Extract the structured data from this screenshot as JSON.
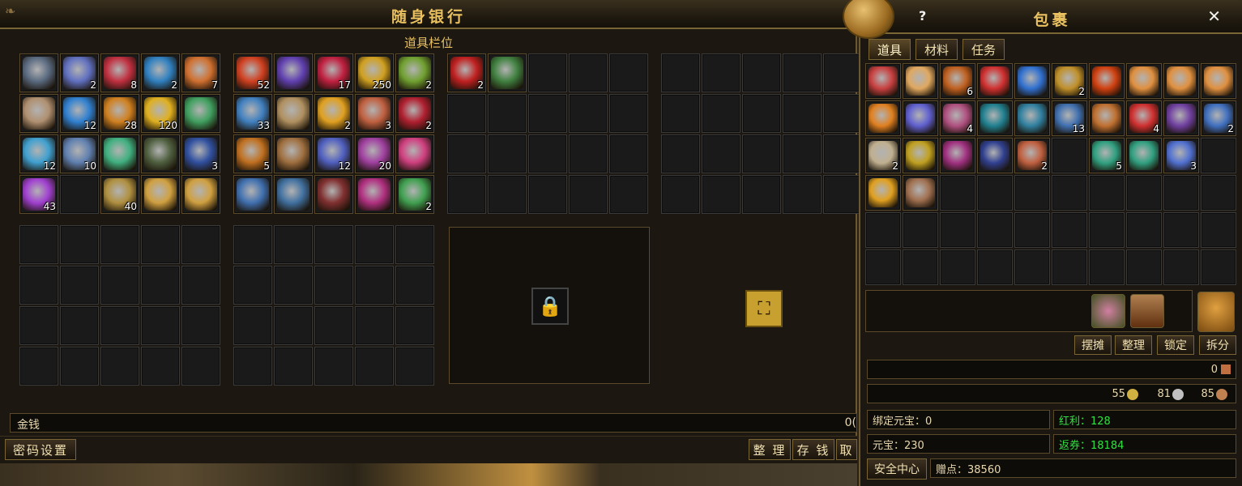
{
  "bank": {
    "title": "随身银行",
    "subtitle": "道具栏位",
    "money_label": "金钱",
    "money_value": "0(",
    "buttons": {
      "password": "密码设置",
      "sort": "整 理",
      "deposit": "存 钱",
      "withdraw": "取"
    },
    "icons": {
      "lock": "lock-icon",
      "expand": "expand-chest-icon"
    },
    "grid1_counts": [
      "",
      "2",
      "8",
      "2",
      "7",
      "",
      "12",
      "28",
      "120",
      "",
      "12",
      "10",
      "",
      "",
      "3",
      "43",
      null,
      "40",
      "",
      ""
    ],
    "grid2_counts": [
      "52",
      "",
      "17",
      "250",
      "2",
      "33",
      "",
      "2",
      "3",
      "2",
      "5",
      "",
      "12",
      "20",
      "",
      "",
      "",
      "",
      "",
      "2"
    ],
    "grid3_counts": [
      "2",
      ""
    ]
  },
  "pack": {
    "title": "包裹",
    "help": "?",
    "close": "✕",
    "tabs": [
      "道具",
      "材料",
      "任务"
    ],
    "items": [
      {
        "c": "#c84040",
        "n": ""
      },
      {
        "c": "#e0a860",
        "n": ""
      },
      {
        "c": "#c06020",
        "n": "6"
      },
      {
        "c": "#d03030",
        "n": ""
      },
      {
        "c": "#3070d0",
        "n": ""
      },
      {
        "c": "#c0902a",
        "n": "2"
      },
      {
        "c": "#d04010",
        "n": ""
      },
      {
        "c": "#e09040",
        "n": ""
      },
      {
        "c": "#e09040",
        "n": ""
      },
      {
        "c": "#e09040",
        "n": ""
      },
      {
        "c": "#e08020",
        "n": ""
      },
      {
        "c": "#6060d0",
        "n": ""
      },
      {
        "c": "#b05080",
        "n": "4"
      },
      {
        "c": "#208090",
        "n": ""
      },
      {
        "c": "#3080a0",
        "n": ""
      },
      {
        "c": "#4070b0",
        "n": "13"
      },
      {
        "c": "#c07030",
        "n": ""
      },
      {
        "c": "#d03030",
        "n": "4"
      },
      {
        "c": "#7040a0",
        "n": ""
      },
      {
        "c": "#4070c0",
        "n": "2"
      },
      {
        "c": "#c0b090",
        "n": "2"
      },
      {
        "c": "#c0a020",
        "n": ""
      },
      {
        "c": "#a03080",
        "n": ""
      },
      {
        "c": "#304090",
        "n": ""
      },
      {
        "c": "#c06040",
        "n": "2"
      },
      null,
      {
        "c": "#30a080",
        "n": "5"
      },
      {
        "c": "#30a080",
        "n": ""
      },
      {
        "c": "#5070d0",
        "n": "3"
      },
      null,
      {
        "c": "#e0a020",
        "n": ""
      },
      {
        "c": "#a07050",
        "n": ""
      }
    ],
    "actions": [
      "摆摊",
      "整理",
      "锁定",
      "拆分"
    ],
    "currency1": "0",
    "gold": "55",
    "silver": "81",
    "copper": "85",
    "bound_yuanbao": "绑定元宝：0",
    "dividend": "红利：128",
    "yuanbao": "元宝：230",
    "voucher": "返券：18184",
    "security": "安全中心",
    "gift_points": "赠点：38560"
  }
}
